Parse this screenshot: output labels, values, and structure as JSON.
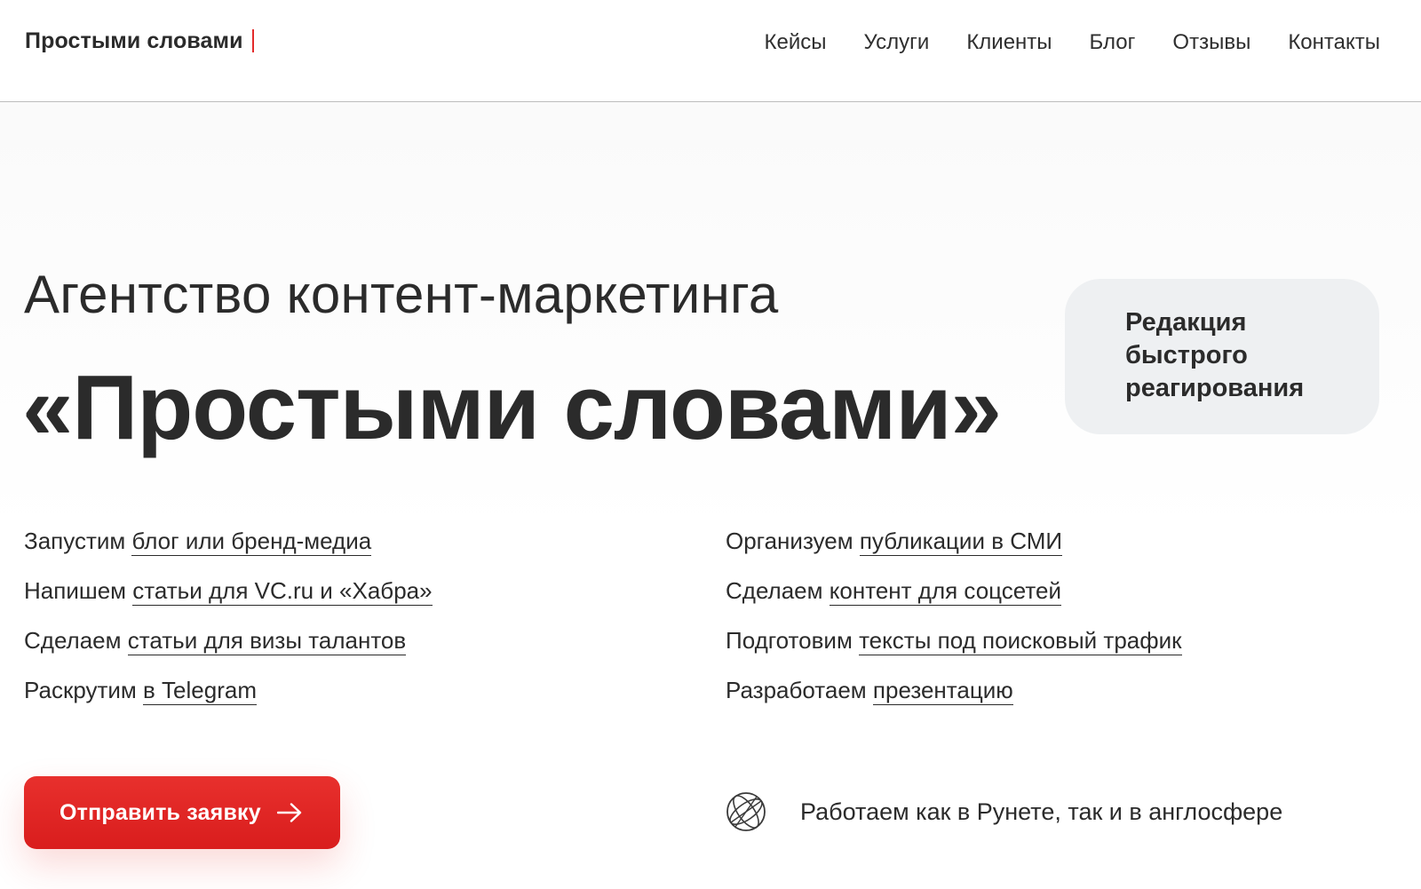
{
  "header": {
    "logo": "Простыми словами",
    "nav": [
      "Кейсы",
      "Услуги",
      "Клиенты",
      "Блог",
      "Отзывы",
      "Контакты"
    ]
  },
  "hero": {
    "subtitle": "Агентство контент-маркетинга",
    "title": "«Простыми словами»",
    "badge": [
      "Редакция",
      "быстрого",
      "реагирования"
    ]
  },
  "services": {
    "left": [
      {
        "prefix": "Запустим ",
        "link": "блог или бренд-медиа"
      },
      {
        "prefix": "Напишем ",
        "link": "статьи для VC.ru и «Хабра»"
      },
      {
        "prefix": "Сделаем ",
        "link": "статьи для визы талантов"
      },
      {
        "prefix": "Раскрутим ",
        "link": "в Telegram"
      }
    ],
    "right": [
      {
        "prefix": "Организуем ",
        "link": "публикации в СМИ"
      },
      {
        "prefix": "Сделаем ",
        "link": "контент для соцсетей"
      },
      {
        "prefix": "Подготовим ",
        "link": "тексты под поисковый трафик"
      },
      {
        "prefix": "Разработаем ",
        "link": "презентацию"
      }
    ]
  },
  "cta": {
    "label": "Отправить заявку",
    "icon": "arrow-right-icon"
  },
  "note": {
    "icon": "globe-icon",
    "text": "Работаем как в Рунете, так и в англосфере"
  },
  "colors": {
    "accent": "#e32b2b",
    "text": "#2b2b2b",
    "badge_bg": "#eef0f2"
  }
}
